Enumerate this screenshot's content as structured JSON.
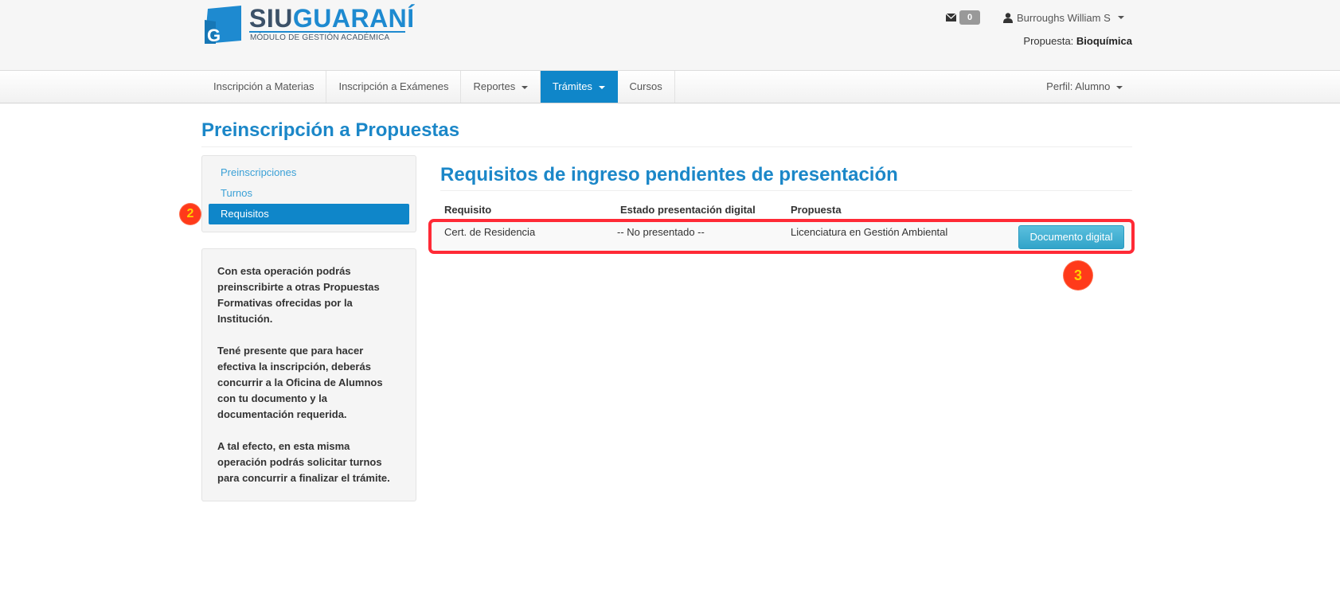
{
  "brand": {
    "title_part1": "SIU",
    "title_part2": "GUARANÍ",
    "subtitle": "MÓDULO DE GESTIÓN ACADÉMICA",
    "icon": "g-logo-icon",
    "color_dark": "#3c5168",
    "color_blue": "#1e8ad0"
  },
  "header": {
    "messages_icon": "envelope-icon",
    "messages_count": "0",
    "user_icon": "user-icon",
    "user_name": "Burroughs William S",
    "propuesta_label": "Propuesta:",
    "propuesta_value": "Bioquímica"
  },
  "nav": {
    "items": [
      {
        "label": "Inscripción a Materias",
        "dropdown": false,
        "active": false
      },
      {
        "label": "Inscripción a Exámenes",
        "dropdown": false,
        "active": false
      },
      {
        "label": "Reportes",
        "dropdown": true,
        "active": false
      },
      {
        "label": "Trámites",
        "dropdown": true,
        "active": true
      },
      {
        "label": "Cursos",
        "dropdown": false,
        "active": false
      }
    ],
    "perfil": "Perfil: Alumno",
    "active_color": "#0f86c9"
  },
  "page": {
    "title": "Preinscripción a Propuestas"
  },
  "sidebar": {
    "items": [
      {
        "label": "Preinscripciones",
        "active": false
      },
      {
        "label": "Turnos",
        "active": false
      },
      {
        "label": "Requisitos",
        "active": true
      }
    ],
    "info": [
      "Con esta operación podrás preinscribirte a otras Propuestas Formativas ofrecidas por la Institución.",
      "Tené presente que para hacer efectiva la inscripción, deberás concurrir a la Oficina de Alumnos con tu documento y la documentación requerida.",
      "A tal efecto, en esta misma operación podrás solicitar turnos para concurrir a finalizar el trámite."
    ]
  },
  "main": {
    "section_title": "Requisitos de ingreso pendientes de presentación",
    "table": {
      "headers": [
        "Requisito",
        "Estado presentación digital",
        "Propuesta"
      ],
      "rows": [
        {
          "requisito": "Cert. de Residencia",
          "estado": "-- No presentado --",
          "propuesta": "Licenciatura en Gestión Ambiental",
          "action": "Documento digital"
        }
      ]
    }
  },
  "annotations": {
    "marker_2": "2",
    "marker_3": "3",
    "highlight_color": "#ff2a36"
  }
}
